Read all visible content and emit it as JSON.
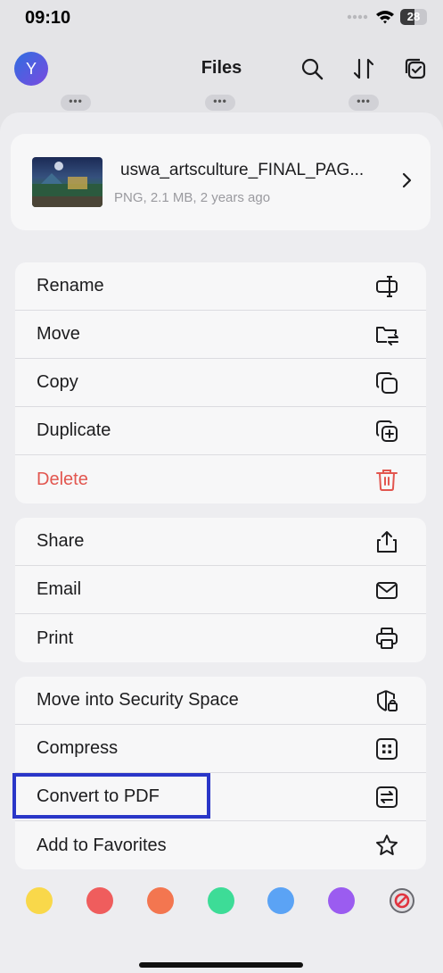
{
  "status_bar": {
    "time": "09:10",
    "battery": "28"
  },
  "app_bar": {
    "avatar_letter": "Y",
    "title": "Files",
    "icons": [
      "search-icon",
      "sort-icon",
      "select-icon"
    ]
  },
  "file": {
    "name": "uswa_artsculture_FINAL_PAG...",
    "meta": "PNG, 2.1 MB, 2 years ago"
  },
  "group1": [
    {
      "label": "Rename",
      "icon": "rename-icon"
    },
    {
      "label": "Move",
      "icon": "move-folder-icon"
    },
    {
      "label": "Copy",
      "icon": "copy-icon"
    },
    {
      "label": "Duplicate",
      "icon": "duplicate-icon"
    },
    {
      "label": "Delete",
      "icon": "trash-icon",
      "color": "#e2564f"
    }
  ],
  "group2": [
    {
      "label": "Share",
      "icon": "share-icon"
    },
    {
      "label": "Email",
      "icon": "mail-icon"
    },
    {
      "label": "Print",
      "icon": "printer-icon"
    }
  ],
  "group3": [
    {
      "label": "Move into Security Space",
      "icon": "shield-lock-icon"
    },
    {
      "label": "Compress",
      "icon": "compress-icon"
    },
    {
      "label": "Convert to PDF",
      "icon": "convert-icon"
    },
    {
      "label": "Add to Favorites",
      "icon": "star-icon"
    }
  ],
  "color_tags": [
    "#f9d84a",
    "#ef5d5d",
    "#f37650",
    "#3ddc97",
    "#5ba3f5",
    "#9b5cf0"
  ],
  "highlight_color": "#2a36c8"
}
